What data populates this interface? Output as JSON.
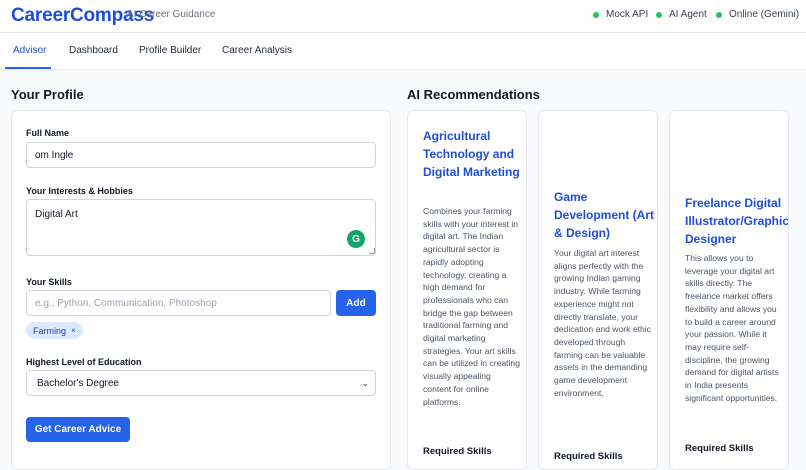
{
  "header": {
    "brand": "CareerCompass",
    "tagline": "AI Career Guidance",
    "statuses": [
      "Mock API",
      "AI Agent",
      "Online (Gemini)"
    ],
    "status_color": "#22c55e"
  },
  "tabs": [
    "Advisor",
    "Dashboard",
    "Profile Builder",
    "Career Analysis"
  ],
  "active_tab": "Advisor",
  "profile": {
    "title": "Your Profile",
    "full_name_label": "Full Name",
    "full_name_value": "om Ingle",
    "interests_label": "Your Interests & Hobbies",
    "interests_value": "Digital Art",
    "skills_label": "Your Skills",
    "skills_placeholder": "e.g., Python, Communication, Photoshop",
    "add_button": "Add",
    "skill_chips": [
      {
        "label": "Farming",
        "remove": "×"
      }
    ],
    "education_label": "Highest Level of Education",
    "education_value": "Bachelor's Degree",
    "submit_button": "Get Career Advice"
  },
  "recommendations": {
    "title": "AI Recommendations",
    "cards": [
      {
        "title": "Agricultural Technology and Digital Marketing",
        "description": "Combines your farming skills with your interest in digital art. The Indian agricultural sector is rapidly adopting technology, creating a high demand for professionals who can bridge the gap between traditional farming and digital marketing strategies. Your art skills can be utilized in creating visually appealing content for online platforms.",
        "required_label": "Required Skills"
      },
      {
        "title": "Game Development (Art & Design)",
        "description": "Your digital art interest aligns perfectly with the growing Indian gaming industry. While farming experience might not directly translate, your dedication and work ethic developed through farming can be valuable assets in the demanding game development environment.",
        "required_label": "Required Skills"
      },
      {
        "title": "Freelance Digital Illustrator/Graphic Designer",
        "description": "This allows you to leverage your digital art skills directly. The freelance market offers flexibility and allows you to build a career around your passion. While it may require self-discipline, the growing demand for digital artists in India presents significant opportunities.",
        "required_label": "Required Skills"
      }
    ]
  },
  "accent_color": "#2563eb",
  "title_color": "#1d4ed8"
}
